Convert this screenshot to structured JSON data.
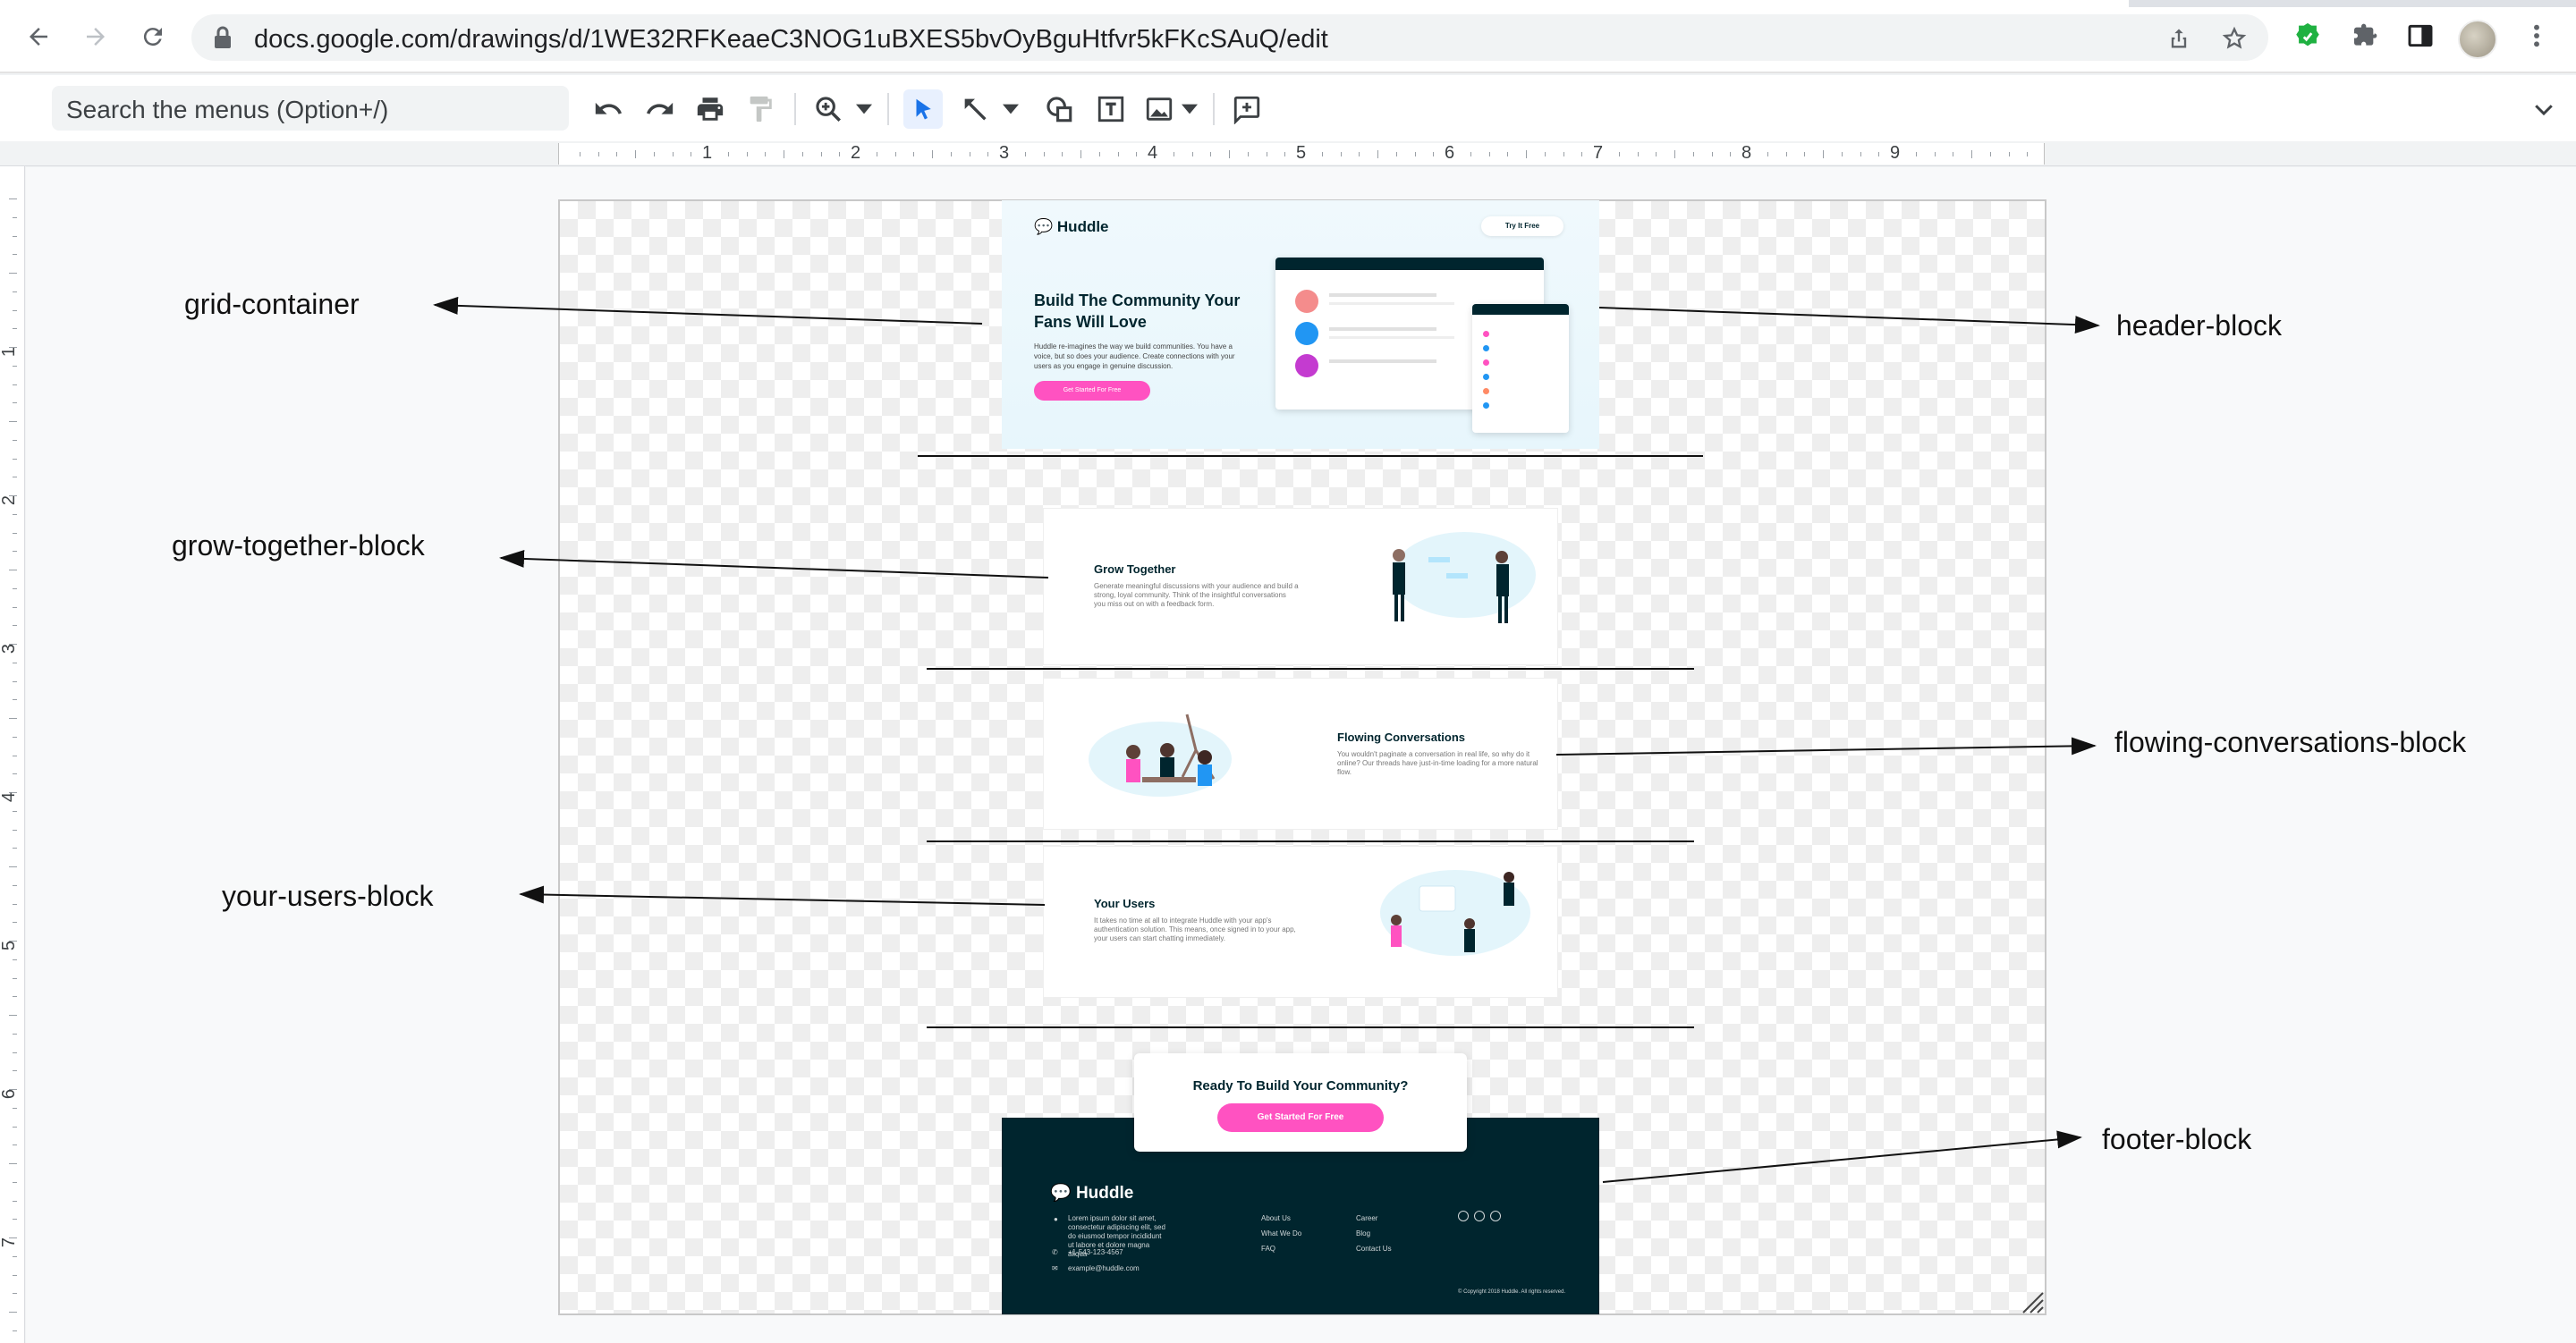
{
  "browser": {
    "url": "docs.google.com/drawings/d/1WE32RFKeaeC3NOG1uBXES5bvOyBguHtfvr5kFKcSAuQ/edit"
  },
  "toolbar": {
    "menu_search_placeholder": "Search the menus (Option+/)",
    "icons": [
      "undo-icon",
      "redo-icon",
      "print-icon",
      "paint-format-icon",
      "zoom-icon",
      "select-icon",
      "line-icon",
      "shape-icon",
      "textbox-icon",
      "image-icon",
      "comment-icon",
      "collapse-icon"
    ]
  },
  "ruler": {
    "horizontal": [
      "1",
      "2",
      "3",
      "4",
      "5",
      "6",
      "7",
      "8",
      "9"
    ],
    "vertical": [
      "1",
      "2",
      "3",
      "4",
      "5",
      "6",
      "7"
    ]
  },
  "annotations": {
    "grid_container": "grid-container",
    "header_block": "header-block",
    "grow_together_block": "grow-together-block",
    "flowing_conversations_block": "flowing-conversations-block",
    "your_users_block": "your-users-block",
    "footer_block": "footer-block"
  },
  "mockup": {
    "header": {
      "logo": "Huddle",
      "try_button": "Try It Free",
      "title": "Build The Community Your Fans Will Love",
      "text": "Huddle re-imagines the way we build communities. You have a voice, but so does your audience. Create connections with your users as you engage in genuine discussion.",
      "cta": "Get Started For Free"
    },
    "grow": {
      "title": "Grow Together",
      "text": "Generate meaningful discussions with your audience and build a strong, loyal community. Think of the insightful conversations you miss out on with a feedback form."
    },
    "flowing": {
      "title": "Flowing Conversations",
      "text": "You wouldn't paginate a conversation in real life, so why do it online? Our threads have just-in-time loading for a more natural flow."
    },
    "users": {
      "title": "Your Users",
      "text": "It takes no time at all to integrate Huddle with your app's authentication solution. This means, once signed in to your app, your users can start chatting immediately."
    },
    "cta": {
      "title": "Ready To Build Your Community?",
      "button": "Get Started For Free"
    },
    "footer": {
      "logo": "Huddle",
      "address": "Lorem ipsum dolor sit amet, consectetur adipiscing elit, sed do eiusmod tempor incididunt ut labore et dolore magna aliqua",
      "phone": "+1-543-123-4567",
      "email": "example@huddle.com",
      "links_col1": [
        "About Us",
        "What We Do",
        "FAQ"
      ],
      "links_col2": [
        "Career",
        "Blog",
        "Contact Us"
      ],
      "copyright": "© Copyright 2018 Huddle. All rights reserved."
    }
  },
  "colors": {
    "accent_pink": "#ff52c1",
    "dark_teal": "#00252e"
  }
}
